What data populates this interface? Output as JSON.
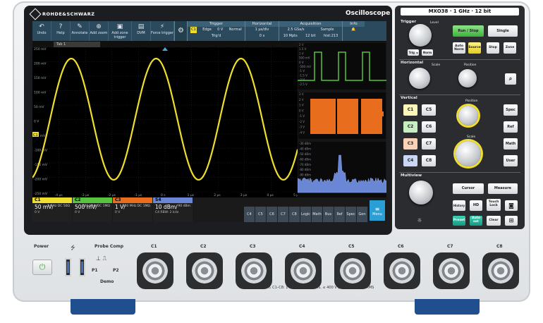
{
  "brand": "ROHDE&SCHWARZ",
  "product": "Oscilloscope",
  "toolbar": {
    "buttons": [
      {
        "icon": "undo-icon",
        "label": "Undo"
      },
      {
        "icon": "help-icon",
        "label": "Help"
      },
      {
        "icon": "annotate-icon",
        "label": "Annotate"
      },
      {
        "icon": "add-zoom-icon",
        "label": "Add zoom"
      },
      {
        "icon": "add-zone-trigger-icon",
        "label": "Add zone trigger"
      },
      {
        "icon": "dvm-icon",
        "label": "DVM"
      },
      {
        "icon": "force-trigger-icon",
        "label": "Force trigger"
      }
    ],
    "trigger": {
      "title": "Trigger",
      "ch": "C1",
      "type": "Edge",
      "level": "0 V",
      "mode": "Normal",
      "status": "Trig'd"
    },
    "horizontal": {
      "title": "Horizontal",
      "scale": "1 µs/div",
      "offset": "0 s"
    },
    "acquisition": {
      "title": "Acquisition",
      "rate": "2.5 GSa/s",
      "points": "10 Mpts",
      "mode": "Sample",
      "bits": "12 bit",
      "hw": "hist:213"
    },
    "info": {
      "title": "Info"
    }
  },
  "tab": {
    "label": "Tab 1"
  },
  "plot": {
    "y_labels": [
      "250 mV",
      "200 mV",
      "150 mV",
      "100 mV",
      "50 mV",
      "0 V",
      "-50 mV",
      "-100 mV",
      "-150 mV",
      "-200 mV",
      "-250 mV"
    ],
    "x_labels": [
      "-5 µs",
      "-4 µs",
      "-3 µs",
      "-2 µs",
      "-1 µs",
      "0 s",
      "1 µs",
      "2 µs",
      "3 µs",
      "4 µs",
      "5 µs"
    ],
    "marker": "C1"
  },
  "side_panels": [
    {
      "y_labels": [
        "2 V",
        "1.5 V",
        "1 V",
        "500 mV",
        "0 V",
        "-500 mV",
        "-1 V",
        "-1.5 V",
        "-2 V",
        "-2.5 V"
      ],
      "color": "#58c33e"
    },
    {
      "y_labels": [
        "3 V",
        "2 V",
        "1 V",
        "0 V",
        "-1 V",
        "-2 V",
        "-3 V",
        "-4 V"
      ],
      "color": "#e86e1d",
      "marker": "C3"
    },
    {
      "y_labels": [
        "-30 dBm",
        "-40 dBm",
        "-50 dBm",
        "-60 dBm",
        "-70 dBm",
        "-80 dBm",
        "-90 dBm",
        "-100 dBm",
        "-110 dBm"
      ],
      "color": "#6a87d6"
    }
  ],
  "channels": [
    {
      "id": "C1",
      "value": "50 mV/",
      "sub": "1 GHz DC 50Ω",
      "offset": "0 V",
      "color": "#f0de2e"
    },
    {
      "id": "C2",
      "value": "500 mV/",
      "sub": "500 MHz DC 1MΩ",
      "offset": "0 V",
      "color": "#58c33e"
    },
    {
      "id": "C3",
      "value": "1 V/",
      "sub": "500 MHz DC 1MΩ",
      "offset": "0 V",
      "color": "#e86e1d"
    },
    {
      "id": "S4",
      "value": "10 dBm/",
      "sub": "90 dBm",
      "offset": "C4   RBW: 2 kHz",
      "color": "#6a87d6"
    }
  ],
  "selector_buttons": [
    "C4",
    "C5",
    "C6",
    "C7",
    "C8",
    "Logic",
    "Math",
    "Bus",
    "Ref",
    "Spec",
    "Gen"
  ],
  "menu_label": "Menu",
  "panel": {
    "title": "MXO38  ·  1 GHz  ·  12 bit",
    "trigger_label": "Trigger",
    "level_label": "Level",
    "run_stop": "Run / Stop",
    "single": "Single",
    "trig_keys": [
      "Trig ◄",
      "Norm"
    ],
    "auto_norm": "Auto Norm",
    "mode_keys": [
      "Source",
      "Stop",
      "Zone"
    ],
    "horizontal_label": "Horizontal",
    "scale_label": "Scale",
    "position_label": "Position",
    "vertical_label": "Vertical",
    "ch_keys_left": [
      "C1",
      "C2",
      "C3",
      "C4"
    ],
    "ch_keys_right": [
      "C5",
      "C6",
      "C7",
      "C8"
    ],
    "v_side_keys": [
      "Spec",
      "Ref",
      "Math",
      "User"
    ],
    "multiview_label": "Multiview",
    "cursor": "Cursor",
    "measure": "Measure",
    "bottom_keys": [
      "History",
      "HD",
      "Touch Lock"
    ],
    "last_keys": [
      "Preset",
      "Auto set",
      "Clear"
    ]
  },
  "front": {
    "power_label": "Power",
    "probe_comp": "Probe Comp",
    "demo": "Demo",
    "p1": "P1",
    "p2": "P2",
    "ports": [
      "C1",
      "C2",
      "C3",
      "C4",
      "C5",
      "C6",
      "C7",
      "C8"
    ],
    "warning": "C1–C8: 1 MΩ: ≤ 300 V RMS, ≤ 400 V pk; 50 Ω: ≤ 5 V RMS"
  }
}
